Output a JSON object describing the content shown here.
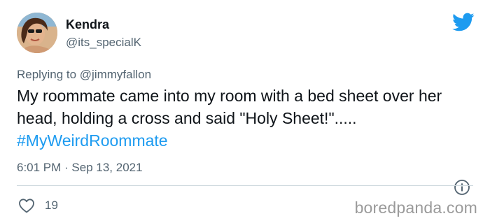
{
  "author": {
    "display_name": "Kendra",
    "handle": "@its_specialK"
  },
  "reply": {
    "prefix": "Replying to ",
    "mention": "@jimmyfallon"
  },
  "tweet": {
    "text": "My roommate came into my room with a bed sheet over her head, holding a cross and said \"Holy Sheet!\"..... ",
    "hashtag": "#MyWeirdRoommate"
  },
  "meta": {
    "timestamp": "6:01 PM · Sep 13, 2021"
  },
  "actions": {
    "like_count": "19"
  },
  "watermark": "boredpanda.com",
  "colors": {
    "twitter_blue": "#1d9bf0",
    "secondary_text": "#536471",
    "primary_text": "#0f1419"
  },
  "icons": {
    "brand": "twitter-bird-icon",
    "info": "info-icon",
    "like": "heart-icon"
  }
}
